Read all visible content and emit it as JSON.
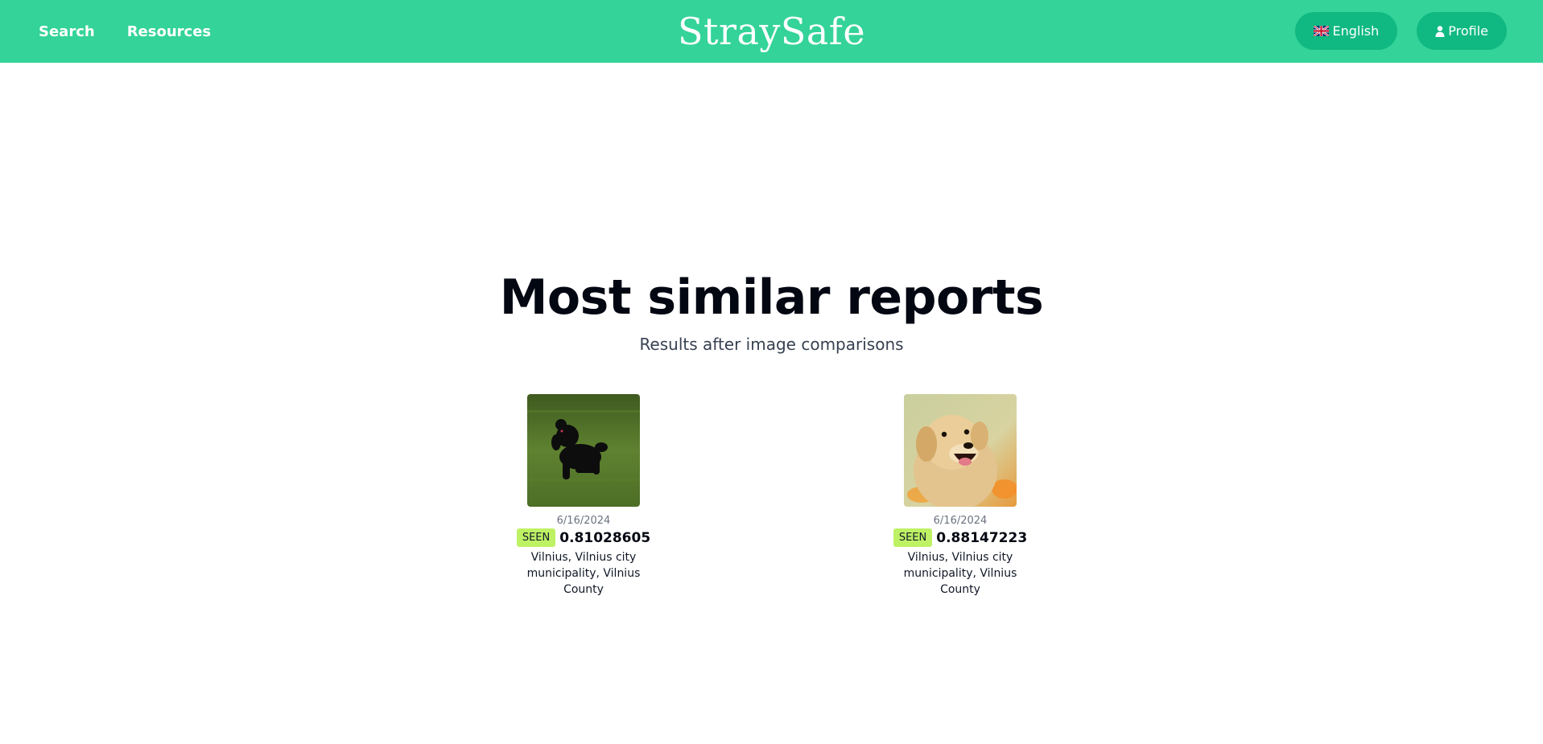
{
  "nav": {
    "links": [
      "Search",
      "Resources"
    ],
    "brand": "StraySafe",
    "language_label": "English",
    "profile_label": "Profile"
  },
  "page": {
    "title": "Most similar reports",
    "subtitle": "Results after image comparisons"
  },
  "results": [
    {
      "image": "black poodle running on grass",
      "date": "6/16/2024",
      "status": "SEEN",
      "score": "0.81028605",
      "location": "Vilnius, Vilnius city municipality, Vilnius County"
    },
    {
      "image": "golden retriever puppy smiling",
      "date": "6/16/2024",
      "status": "SEEN",
      "score": "0.88147223",
      "location": "Vilnius, Vilnius city municipality, Vilnius County"
    }
  ],
  "colors": {
    "navbar": "#34d399",
    "pill": "#10b981",
    "badge": "#bef264"
  }
}
